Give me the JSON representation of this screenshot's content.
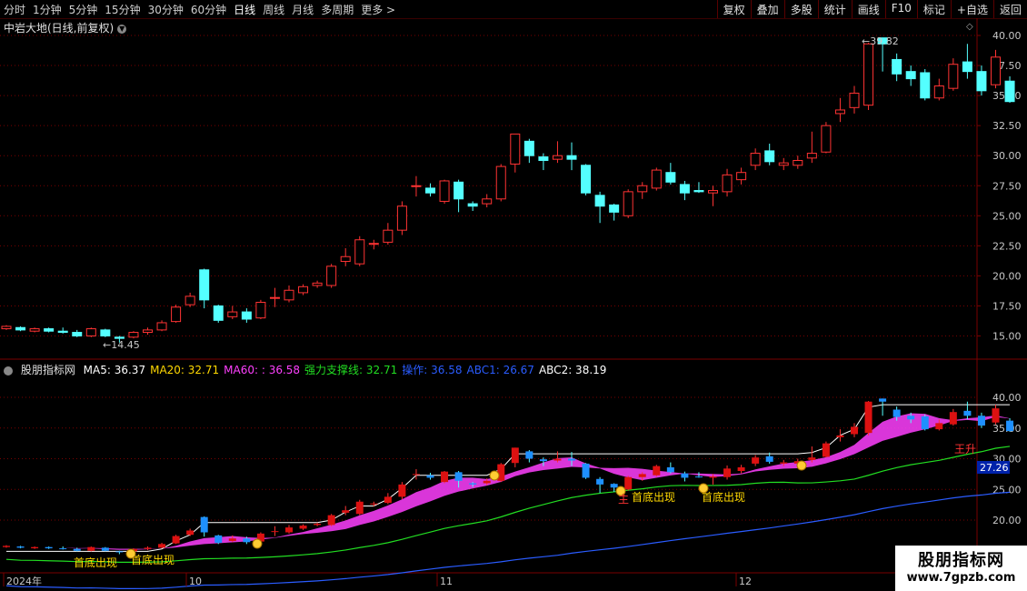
{
  "toolbar": {
    "periods": [
      "分时",
      "1分钟",
      "5分钟",
      "15分钟",
      "30分钟",
      "60分钟",
      "日线",
      "周线",
      "月线",
      "多周期",
      "更多"
    ],
    "active_period": "日线",
    "more_arrow": ">",
    "actions": [
      "复权",
      "叠加",
      "多股",
      "统计",
      "画线",
      "F10",
      "标记",
      "+自选",
      "返回"
    ]
  },
  "stock": {
    "title": "中岩大地(日线,前复权)",
    "high_label": "39.82",
    "low_label": "14.45"
  },
  "colors": {
    "up": "#ff3333",
    "down": "#54ffff",
    "grid": "#7a0000",
    "ma5": "#ffffff",
    "ma20": "#ffd800",
    "ma60": "#ff40ff",
    "support": "#22dd22",
    "ops": "#2a5cff",
    "abc1": "#2a5cff",
    "abc2": "#ffffff"
  },
  "main_axis": [
    "40.00",
    "37.50",
    "35.00",
    "32.50",
    "30.00",
    "27.50",
    "25.00",
    "22.50",
    "20.00",
    "17.50",
    "15.00"
  ],
  "indicator": {
    "name": "股朋指标网",
    "items": [
      {
        "label": "MA5:",
        "value": "36.37",
        "color": "#ffffff"
      },
      {
        "label": "MA20:",
        "value": "32.71",
        "color": "#ffd800"
      },
      {
        "label": "MA60:",
        "value": ": 36.58",
        "color": "#ff40ff"
      },
      {
        "label": "强力支撑线:",
        "value": "32.71",
        "color": "#22dd22"
      },
      {
        "label": "操作:",
        "value": "36.58",
        "color": "#2a5cff"
      },
      {
        "label": "ABC1:",
        "value": "26.67",
        "color": "#2a5cff"
      },
      {
        "label": "ABC2:",
        "value": "38.19",
        "color": "#ffffff"
      }
    ],
    "axis": [
      "40.00",
      "35.00",
      "30.00",
      "25.00",
      "20.00"
    ],
    "current_tag": "27.26",
    "signal_label": "首底出现",
    "zhu_label": "主",
    "wang_label": "王升"
  },
  "date_axis": [
    "2024年",
    "10",
    "11",
    "12"
  ],
  "watermark": {
    "line1": "股朋指标网",
    "line2": "www.7gpzb.com"
  },
  "chart_data": {
    "type": "candlestick",
    "title": "中岩大地(日线,前复权)",
    "ylim": [
      13.5,
      41.5
    ],
    "candles": [
      {
        "o": 15.6,
        "c": 15.8,
        "h": 15.9,
        "l": 15.5
      },
      {
        "o": 15.7,
        "c": 15.5,
        "h": 15.8,
        "l": 15.4
      },
      {
        "o": 15.4,
        "c": 15.6,
        "h": 15.7,
        "l": 15.3
      },
      {
        "o": 15.6,
        "c": 15.4,
        "h": 15.7,
        "l": 15.3
      },
      {
        "o": 15.4,
        "c": 15.3,
        "h": 15.7,
        "l": 15.2
      },
      {
        "o": 15.3,
        "c": 15.0,
        "h": 15.5,
        "l": 14.9
      },
      {
        "o": 15.0,
        "c": 15.6,
        "h": 15.7,
        "l": 14.9
      },
      {
        "o": 15.5,
        "c": 15.0,
        "h": 15.6,
        "l": 14.9
      },
      {
        "o": 14.9,
        "c": 14.8,
        "h": 15.0,
        "l": 14.45
      },
      {
        "o": 14.9,
        "c": 15.3,
        "h": 15.4,
        "l": 14.8
      },
      {
        "o": 15.3,
        "c": 15.5,
        "h": 15.7,
        "l": 15.1
      },
      {
        "o": 15.5,
        "c": 16.1,
        "h": 16.3,
        "l": 15.4
      },
      {
        "o": 16.2,
        "c": 17.4,
        "h": 17.6,
        "l": 16.1
      },
      {
        "o": 17.6,
        "c": 18.3,
        "h": 18.6,
        "l": 17.4
      },
      {
        "o": 20.5,
        "c": 18.0,
        "h": 20.6,
        "l": 17.3
      },
      {
        "o": 17.5,
        "c": 16.3,
        "h": 17.6,
        "l": 16.1
      },
      {
        "o": 16.6,
        "c": 17.0,
        "h": 17.5,
        "l": 16.4
      },
      {
        "o": 17.0,
        "c": 16.4,
        "h": 17.3,
        "l": 16.1
      },
      {
        "o": 16.5,
        "c": 17.8,
        "h": 18.0,
        "l": 16.4
      },
      {
        "o": 18.2,
        "c": 18.2,
        "h": 19.0,
        "l": 17.4
      },
      {
        "o": 18.0,
        "c": 18.8,
        "h": 19.2,
        "l": 17.8
      },
      {
        "o": 18.6,
        "c": 19.1,
        "h": 19.3,
        "l": 18.4
      },
      {
        "o": 19.2,
        "c": 19.4,
        "h": 19.6,
        "l": 19.0
      },
      {
        "o": 19.2,
        "c": 20.8,
        "h": 21.0,
        "l": 19.0
      },
      {
        "o": 21.2,
        "c": 21.6,
        "h": 22.3,
        "l": 20.8
      },
      {
        "o": 21.0,
        "c": 23.0,
        "h": 23.3,
        "l": 20.8
      },
      {
        "o": 22.7,
        "c": 22.7,
        "h": 23.0,
        "l": 22.2
      },
      {
        "o": 22.8,
        "c": 23.8,
        "h": 24.4,
        "l": 22.6
      },
      {
        "o": 23.8,
        "c": 25.8,
        "h": 26.2,
        "l": 23.4
      },
      {
        "o": 27.5,
        "c": 27.5,
        "h": 28.3,
        "l": 26.6
      },
      {
        "o": 27.3,
        "c": 26.9,
        "h": 27.7,
        "l": 26.6
      },
      {
        "o": 26.2,
        "c": 27.9,
        "h": 28.0,
        "l": 26.0
      },
      {
        "o": 27.8,
        "c": 26.4,
        "h": 28.0,
        "l": 25.3
      },
      {
        "o": 26.0,
        "c": 25.8,
        "h": 26.2,
        "l": 25.4
      },
      {
        "o": 26.0,
        "c": 26.4,
        "h": 26.8,
        "l": 25.7
      },
      {
        "o": 26.4,
        "c": 29.1,
        "h": 29.3,
        "l": 26.2
      },
      {
        "o": 29.3,
        "c": 31.8,
        "h": 31.8,
        "l": 28.6
      },
      {
        "o": 31.2,
        "c": 30.0,
        "h": 31.4,
        "l": 29.4
      },
      {
        "o": 29.9,
        "c": 29.6,
        "h": 30.2,
        "l": 28.8
      },
      {
        "o": 29.7,
        "c": 30.0,
        "h": 31.2,
        "l": 29.4
      },
      {
        "o": 30.0,
        "c": 29.7,
        "h": 31.1,
        "l": 28.8
      },
      {
        "o": 29.2,
        "c": 26.9,
        "h": 29.3,
        "l": 26.7
      },
      {
        "o": 26.7,
        "c": 25.8,
        "h": 27.0,
        "l": 24.4
      },
      {
        "o": 25.9,
        "c": 25.3,
        "h": 26.0,
        "l": 24.6
      },
      {
        "o": 25.0,
        "c": 27.0,
        "h": 27.2,
        "l": 24.8
      },
      {
        "o": 27.0,
        "c": 27.5,
        "h": 27.8,
        "l": 26.4
      },
      {
        "o": 27.3,
        "c": 28.8,
        "h": 29.0,
        "l": 27.1
      },
      {
        "o": 28.6,
        "c": 27.8,
        "h": 29.4,
        "l": 27.6
      },
      {
        "o": 27.6,
        "c": 26.9,
        "h": 27.9,
        "l": 26.3
      },
      {
        "o": 27.1,
        "c": 27.0,
        "h": 27.8,
        "l": 26.9
      },
      {
        "o": 26.9,
        "c": 27.1,
        "h": 27.5,
        "l": 25.8
      },
      {
        "o": 27.0,
        "c": 28.4,
        "h": 28.9,
        "l": 26.6
      },
      {
        "o": 28.0,
        "c": 28.6,
        "h": 29.0,
        "l": 27.6
      },
      {
        "o": 29.2,
        "c": 30.2,
        "h": 30.6,
        "l": 28.8
      },
      {
        "o": 30.4,
        "c": 29.5,
        "h": 31.0,
        "l": 29.2
      },
      {
        "o": 29.2,
        "c": 29.4,
        "h": 29.8,
        "l": 28.8
      },
      {
        "o": 29.2,
        "c": 29.6,
        "h": 30.0,
        "l": 28.9
      },
      {
        "o": 29.8,
        "c": 30.2,
        "h": 32.0,
        "l": 29.4
      },
      {
        "o": 30.3,
        "c": 32.5,
        "h": 32.8,
        "l": 30.2
      },
      {
        "o": 33.5,
        "c": 33.8,
        "h": 34.8,
        "l": 32.8
      },
      {
        "o": 34.0,
        "c": 35.2,
        "h": 35.8,
        "l": 33.5
      },
      {
        "o": 34.2,
        "c": 39.3,
        "h": 39.4,
        "l": 33.8
      },
      {
        "o": 39.8,
        "c": 39.3,
        "h": 39.8,
        "l": 37.0
      },
      {
        "o": 38.0,
        "c": 36.8,
        "h": 38.5,
        "l": 36.2
      },
      {
        "o": 37.0,
        "c": 36.4,
        "h": 37.5,
        "l": 35.8
      },
      {
        "o": 36.9,
        "c": 34.8,
        "h": 37.2,
        "l": 34.6
      },
      {
        "o": 34.8,
        "c": 35.8,
        "h": 36.4,
        "l": 34.6
      },
      {
        "o": 35.6,
        "c": 37.6,
        "h": 38.1,
        "l": 35.4
      },
      {
        "o": 37.8,
        "c": 37.0,
        "h": 39.3,
        "l": 36.4
      },
      {
        "o": 37.0,
        "c": 35.4,
        "h": 37.5,
        "l": 35.0
      },
      {
        "o": 35.9,
        "c": 38.2,
        "h": 38.8,
        "l": 35.6
      },
      {
        "o": 36.2,
        "c": 34.5,
        "h": 36.6,
        "l": 34.4
      }
    ]
  }
}
